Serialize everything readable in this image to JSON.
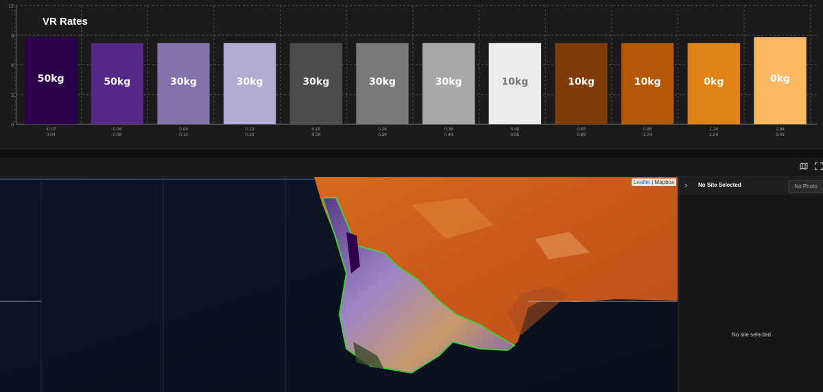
{
  "chart_data": {
    "type": "bar",
    "title": "VR Rates",
    "yticks": [
      0,
      3,
      6,
      9,
      12
    ],
    "ylim": [
      0,
      12
    ],
    "grid": true,
    "categories": [
      [
        "-0.07",
        "0.04"
      ],
      [
        "0.04",
        "0.09"
      ],
      [
        "0.09",
        "0.13"
      ],
      [
        "0.13",
        "0.19"
      ],
      [
        "0.19",
        "0.26"
      ],
      [
        "0.26",
        "0.36"
      ],
      [
        "0.36",
        "0.49"
      ],
      [
        "0.49",
        "0.65"
      ],
      [
        "0.65",
        "0.88"
      ],
      [
        "0.88",
        "1.24"
      ],
      [
        "1.24",
        "1.84"
      ],
      [
        "1.84",
        "3.41"
      ]
    ],
    "values": [
      8.8,
      8.2,
      8.2,
      8.2,
      8.2,
      8.2,
      8.2,
      8.2,
      8.2,
      8.2,
      8.2,
      8.8
    ],
    "labels": [
      "50kg",
      "50kg",
      "30kg",
      "30kg",
      "30kg",
      "30kg",
      "30kg",
      "10kg",
      "10kg",
      "10kg",
      "0kg",
      "0kg"
    ],
    "colors": [
      "#2d004b",
      "#542788",
      "#8073ac",
      "#b2abd2",
      "#4d4d4d",
      "#7a7a7a",
      "#a9a9a9",
      "#ececec",
      "#7f3b08",
      "#b35806",
      "#e08214",
      "#fdb863"
    ],
    "label_colors": [
      "#ffffff",
      "#ffffff",
      "#ffffff",
      "#ffffff",
      "#ffffff",
      "#ffffff",
      "#ffffff",
      "#777777",
      "#ffffff",
      "#ffffff",
      "#ffffff",
      "#ffffff"
    ]
  },
  "toolbar": {
    "map_icon": "map-icon",
    "fullscreen_icon": "fullscreen-icon"
  },
  "map": {
    "attribution_leaflet": "Leaflet",
    "attribution_sep": " | ",
    "attribution_mapbox": "Mapbox"
  },
  "site_panel": {
    "title": "No Site Selected",
    "photo_button": "No Photo",
    "empty_text": "No site selected"
  }
}
